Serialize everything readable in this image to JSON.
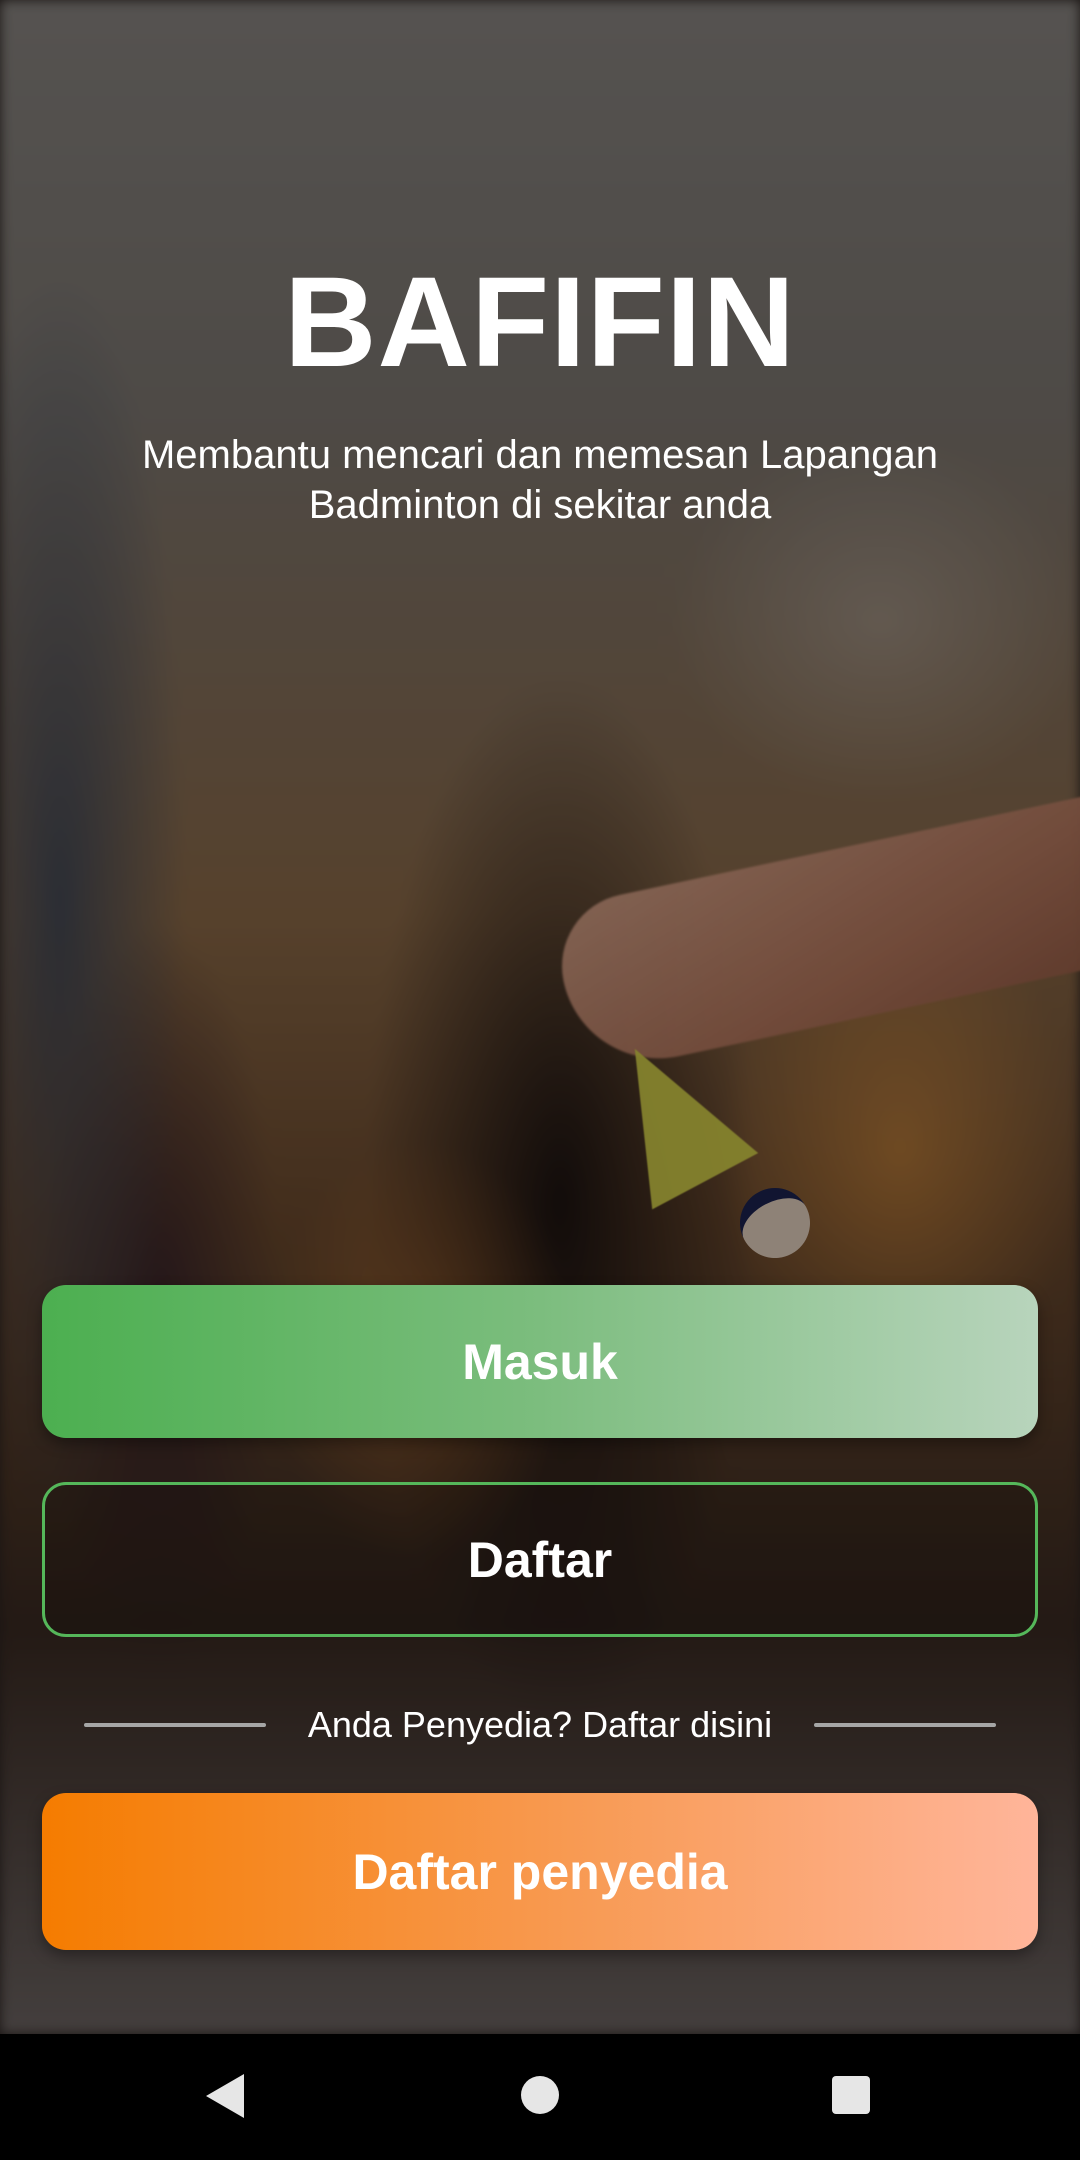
{
  "app": {
    "title": "BAFIFIN",
    "subtitle": "Membantu mencari dan memesan Lapangan Badminton di sekitar anda"
  },
  "buttons": {
    "login_label": "Masuk",
    "register_label": "Daftar",
    "provider_label": "Daftar penyedia"
  },
  "divider": {
    "text": "Anda Penyedia? Daftar disini"
  },
  "colors": {
    "primary_green": "#4caf50",
    "outline_green": "#55b75a",
    "accent_orange": "#f57c00"
  },
  "navbar": {
    "back_icon": "back-triangle",
    "home_icon": "home-circle",
    "recents_icon": "recents-square"
  }
}
